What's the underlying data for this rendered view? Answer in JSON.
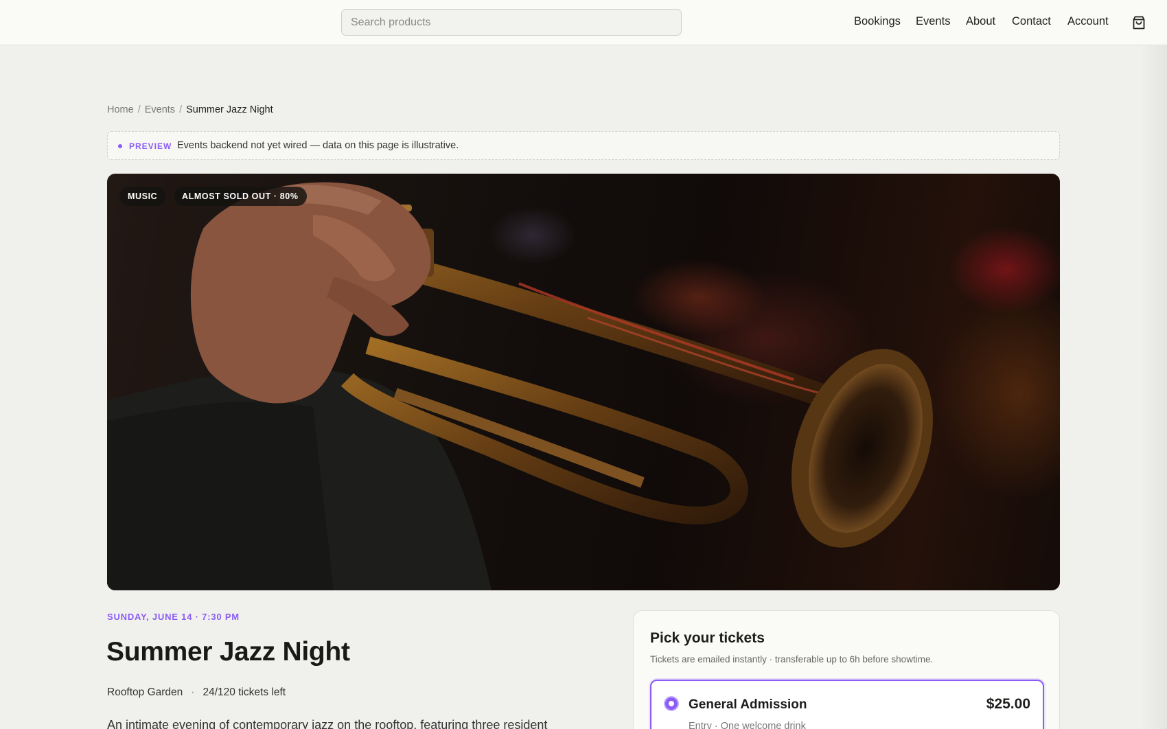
{
  "header": {
    "search_placeholder": "Search products",
    "nav": [
      "Bookings",
      "Events",
      "About",
      "Contact",
      "Account"
    ],
    "cart_icon": "shopping-bag-icon"
  },
  "breadcrumb": {
    "items": [
      "Home",
      "Events"
    ],
    "current": "Summer Jazz Night",
    "separator": "/"
  },
  "notice": {
    "tag": "PREVIEW",
    "message": "Events backend not yet wired — data on this page is illustrative."
  },
  "hero": {
    "badges": [
      "MUSIC",
      "ALMOST SOLD OUT · 80%"
    ]
  },
  "event": {
    "date": "SUNDAY, JUNE 14 · 7:30 PM",
    "title": "Summer Jazz Night",
    "venue": "Rooftop Garden",
    "tickets_left": "24/120 tickets left",
    "meta_separator": "·",
    "description": "An intimate evening of contemporary jazz on the rooftop, featuring three resident"
  },
  "tickets": {
    "heading": "Pick your tickets",
    "subtitle": "Tickets are emailed instantly · transferable up to 6h before showtime.",
    "options": [
      {
        "name": "General Admission",
        "price": "$25.00",
        "detail": "Entry · One welcome drink",
        "selected": true
      }
    ]
  },
  "colors": {
    "accent": "#8b5cf6",
    "background": "#f0f1ed",
    "header": "#fafaf7"
  }
}
